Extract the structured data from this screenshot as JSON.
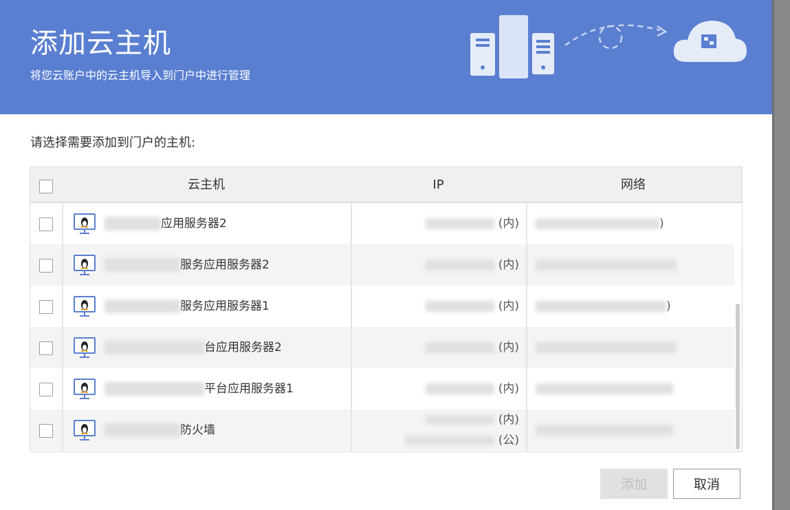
{
  "header": {
    "title": "添加云主机",
    "subtitle": "将您云账户中的云主机导入到门户中进行管理",
    "accent_color": "#5a7fd1"
  },
  "prompt": "请选择需要添加到门户的主机:",
  "table": {
    "columns": [
      "云主机",
      "IP",
      "网络"
    ],
    "rows": [
      {
        "icon": "linux-icon",
        "name_visible": "应用服务器2",
        "ip": [
          "(内)"
        ],
        "network_visible": ")"
      },
      {
        "icon": "linux-icon",
        "name_visible": "服务应用服务器2",
        "ip": [
          "(内)"
        ],
        "network_visible": ""
      },
      {
        "icon": "linux-icon",
        "name_visible": "服务应用服务器1",
        "ip": [
          "(内)"
        ],
        "network_visible": ")"
      },
      {
        "icon": "linux-icon",
        "name_visible": "台应用服务器2",
        "ip": [
          "(内)"
        ],
        "network_visible": ""
      },
      {
        "icon": "linux-icon",
        "name_visible": "平台应用服务器1",
        "ip": [
          "(内)"
        ],
        "network_visible": ""
      },
      {
        "icon": "linux-icon",
        "name_visible": "防火墙",
        "ip": [
          "(内)",
          "(公)"
        ],
        "network_visible": ""
      }
    ]
  },
  "buttons": {
    "add": "添加",
    "cancel": "取消"
  }
}
